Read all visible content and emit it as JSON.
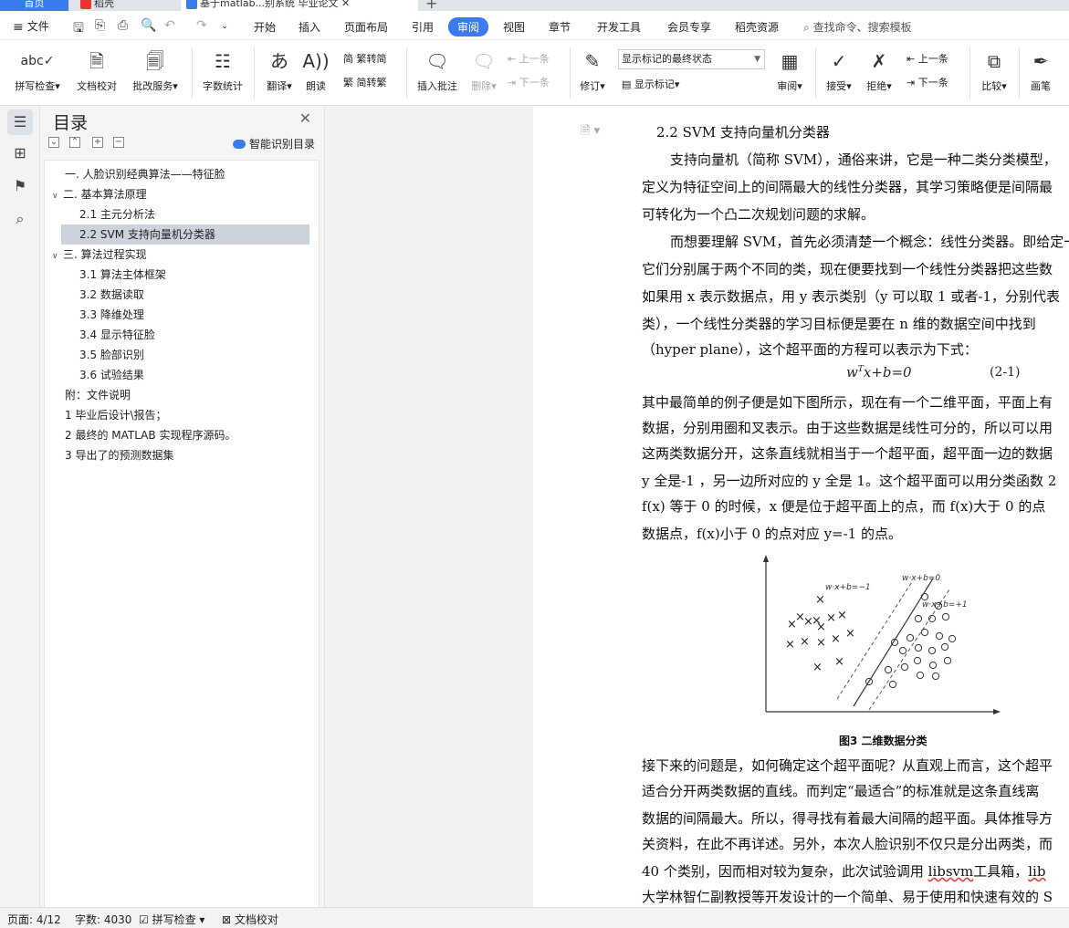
{
  "tabs": {
    "home": "首页",
    "daoke": "稻壳",
    "doc": "基于matlab...别系统 毕业论文"
  },
  "menubar": {
    "file": "文件",
    "items": [
      "开始",
      "插入",
      "页面布局",
      "引用",
      "审阅",
      "视图",
      "章节",
      "开发工具",
      "会员专享",
      "稻壳资源"
    ],
    "active": "审阅",
    "search": "查找命令、搜索模板"
  },
  "ribbon": {
    "spell_check": "拼写检查",
    "doc_check": "文档校对",
    "revise_service": "批改服务",
    "word_count": "字数统计",
    "translate": "翻译",
    "read_aloud": "朗读",
    "trad_to_simp": "繁转简",
    "simp_to_trad": "简转繁",
    "insert_comment": "插入批注",
    "delete": "删除",
    "prev": "上一条",
    "next": "下一条",
    "track": "修订",
    "markup_state": "显示标记的最终状态",
    "show_markup": "显示标记",
    "review": "审阅",
    "accept": "接受",
    "reject": "拒绝",
    "prev2": "上一条",
    "next2": "下一条",
    "compare": "比较",
    "pen": "画笔"
  },
  "toc": {
    "title": "目录",
    "smart_toc": "智能识别目录",
    "items": [
      {
        "text": "一. 人脸识别经典算法——特征脸",
        "level": 0,
        "arrow": ""
      },
      {
        "text": "二. 基本算法原理",
        "level": 0,
        "arrow": "∨"
      },
      {
        "text": "2.1 主元分析法",
        "level": 1,
        "arrow": ""
      },
      {
        "text": "2.2 SVM 支持向量机分类器",
        "level": 1,
        "arrow": ""
      },
      {
        "text": "三. 算法过程实现",
        "level": 0,
        "arrow": "∨"
      },
      {
        "text": "3.1 算法主体框架",
        "level": 1,
        "arrow": ""
      },
      {
        "text": "3.2 数据读取",
        "level": 1,
        "arrow": ""
      },
      {
        "text": "3.3 降维处理",
        "level": 1,
        "arrow": ""
      },
      {
        "text": "3.4 显示特征脸",
        "level": 1,
        "arrow": ""
      },
      {
        "text": "3.5 脸部识别",
        "level": 1,
        "arrow": ""
      },
      {
        "text": "3.6 试验结果",
        "level": 1,
        "arrow": ""
      },
      {
        "text": "附：文件说明",
        "level": 0,
        "arrow": ""
      },
      {
        "text": "1 毕业后设计\\报告；",
        "level": 0,
        "arrow": ""
      },
      {
        "text": "2 最终的 MATLAB 实现程序源码。",
        "level": 0,
        "arrow": ""
      },
      {
        "text": "3 导出了的预测数据集",
        "level": 0,
        "arrow": ""
      }
    ],
    "selected_index": 3
  },
  "doc": {
    "heading": "2.2 SVM 支持向量机分类器",
    "lines": [
      "支持向量机（简称 SVM），通俗来讲，它是一种二类分类模型，",
      "定义为特征空间上的间隔最大的线性分类器，其学习策略便是间隔最",
      "可转化为一个凸二次规划问题的求解。",
      "而想要理解 SVM，首先必须清楚一个概念：线性分类器。即给定一",
      "它们分别属于两个不同的类，现在便要找到一个线性分类器把这些数",
      "如果用 x 表示数据点，用 y 表示类别（y 可以取 1 或者-1，分别代表",
      "类），一个线性分类器的学习目标便是要在 n 维的数据空间中找到",
      "（hyper plane），这个超平面的方程可以表示为下式：",
      "其中最简单的例子便是如下图所示，现在有一个二维平面，平面上有",
      "数据，分别用圈和叉表示。由于这些数据是线性可分的，所以可以用",
      "这两类数据分开，这条直线就相当于一个超平面，超平面一边的数据",
      "y 全是-1 ，另一边所对应的 y 全是 1。这个超平面可以用分类函数 2",
      "f(x) 等于 0 的时候，x 便是位于超平面上的点，而 f(x)大于 0 的点",
      "数据点，f(x)小于 0 的点对应 y=-1 的点。",
      "接下来的问题是，如何确定这个超平面呢？从直观上而言，这个超平",
      "适合分开两类数据的直线。而判定“最适合”的标准就是这条直线离",
      "数据的间隔最大。所以，得寻找有着最大间隔的超平面。具体推导方",
      "关资料，在此不再详述。另外，本次人脸识别不仅只是分出两类，而",
      "40 个类别，因而相对较为复杂，此次试验调用 ",
      "大学林智仁副教授等开发设计的一个简单、易于使用和快速有效的 S"
    ],
    "libsvm_word": "libsvm",
    "libsvm_after": "工具箱，",
    "libsvm_tail": "lib",
    "formula": "w",
    "formula_sup": "T",
    "formula_rest": "x+b=0",
    "eq_number": "(2-1)",
    "figure_labels": {
      "top_left": "w·x+b=−1",
      "top_mid": "w·x+b=0",
      "right": "w·x+b=+1"
    },
    "caption": "图3 二维数据分类"
  },
  "status": {
    "page": "页面: 4/12",
    "words": "字数: 4030",
    "spell": "拼写检查",
    "doc_check": "文档校对"
  },
  "colors": {
    "accent": "#3b7bf0",
    "selection": "#cdd3dc"
  }
}
